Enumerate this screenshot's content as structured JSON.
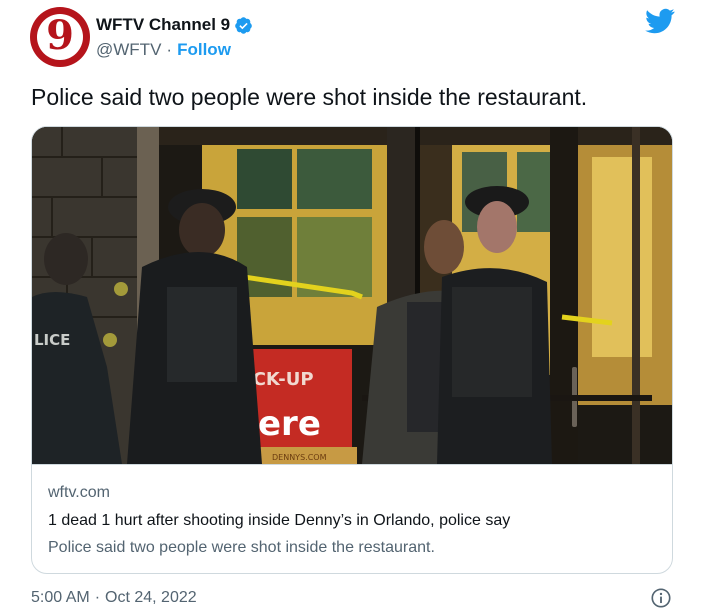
{
  "author": {
    "display_name": "WFTV Channel 9",
    "handle": "@WFTV",
    "separator": "·",
    "follow_label": "Follow",
    "avatar_text": "9"
  },
  "tweet": {
    "text": "Police said two people were shot inside the restaurant."
  },
  "card": {
    "image_sign_text": "ICK-UP",
    "image_sign_text2": "ere",
    "image_vest_text": "LICE",
    "image_footer_text": "DENNYS.COM",
    "domain": "wftv.com",
    "title": "1 dead 1 hurt after shooting inside Denny’s in Orlando, police say",
    "description": "Police said two people were shot inside the restaurant."
  },
  "meta": {
    "time": "5:00 AM",
    "separator": "·",
    "date": "Oct 24, 2022"
  },
  "colors": {
    "accent": "#1d9bf0",
    "brand": "#b5141b",
    "secondary_text": "#536471",
    "primary_text": "#0f1419",
    "border": "#cfd9de"
  },
  "icons": {
    "verified": "verified-badge-icon",
    "bird": "twitter-bird-icon",
    "info": "info-icon"
  }
}
